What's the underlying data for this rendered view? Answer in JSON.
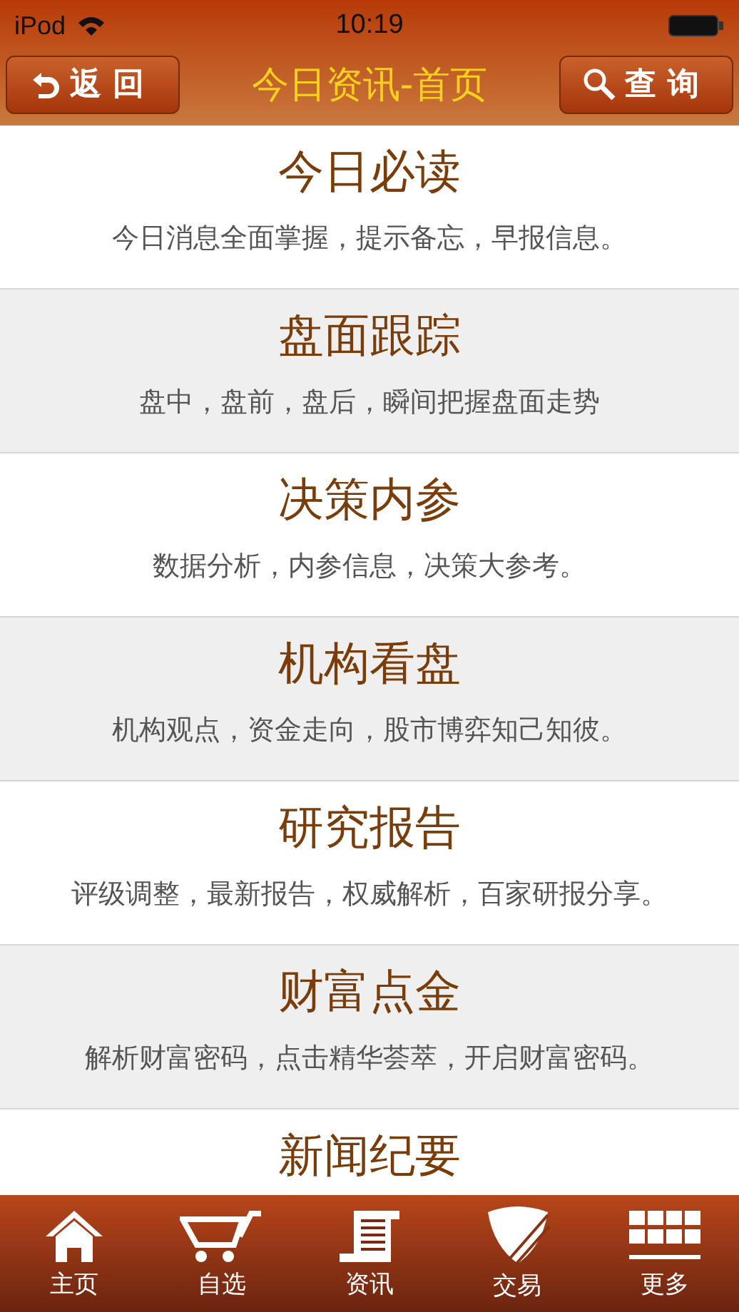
{
  "status_bar": {
    "carrier": "iPod",
    "time": "10:19"
  },
  "nav_bar": {
    "back_button": "返回",
    "title": "今日资讯-首页",
    "search_button": "查询"
  },
  "items": [
    {
      "title": "今日必读",
      "subtitle": "今日消息全面掌握，提示备忘，早报信息。"
    },
    {
      "title": "盘面跟踪",
      "subtitle": "盘中，盘前，盘后，瞬间把握盘面走势"
    },
    {
      "title": "决策内参",
      "subtitle": "数据分析，内参信息，决策大参考。"
    },
    {
      "title": "机构看盘",
      "subtitle": "机构观点，资金走向，股市博弈知己知彼。"
    },
    {
      "title": "研究报告",
      "subtitle": "评级调整，最新报告，权威解析，百家研报分享。"
    },
    {
      "title": "财富点金",
      "subtitle": "解析财富密码，点击精华荟萃，开启财富密码。"
    },
    {
      "title": "新闻纪要"
    }
  ],
  "tab_bar": [
    {
      "kind": "home",
      "label": "主页"
    },
    {
      "kind": "cart",
      "label": "自选"
    },
    {
      "kind": "scroll",
      "label": "资讯"
    },
    {
      "kind": "shield",
      "label": "交易"
    },
    {
      "kind": "grid",
      "label": "更多"
    }
  ]
}
